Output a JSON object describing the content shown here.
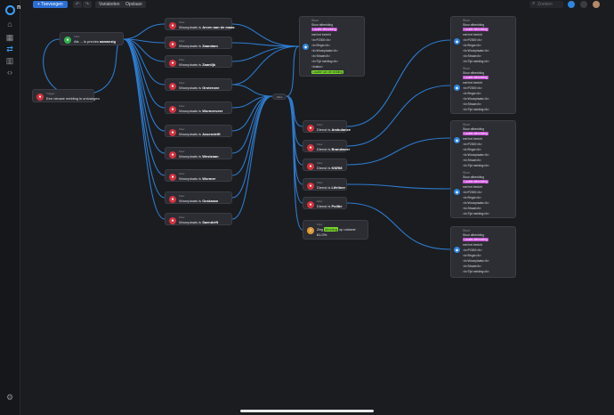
{
  "app": {
    "brand": "n"
  },
  "toolbar": {
    "add_label": "+ Toevoegen",
    "variables_label": "Variabelen",
    "save_label": "Opslaan",
    "search_placeholder": "Zoeken"
  },
  "nodes": {
    "start": {
      "label": "Flow",
      "text": "Als ... is precies",
      "bold": "aanwezig"
    },
    "notice": {
      "label": "Trigger",
      "text": "Een nieuwe melding is ontvangen"
    },
    "wp1": {
      "label": "Flow",
      "text": "Woonplaats is",
      "bold": "Arcen aan de maas"
    },
    "wp2": {
      "label": "Flow",
      "text": "Woonplaats is",
      "bold": "Zaandam"
    },
    "wp3": {
      "label": "Flow",
      "text": "Woonplaats is",
      "bold": "Zaanlijk"
    },
    "wp4": {
      "label": "Flow",
      "text": "Woonplaats is",
      "bold": "Groterone"
    },
    "wp5": {
      "label": "Flow",
      "text": "Woonplaats is",
      "bold": "Wormerveer"
    },
    "wp6": {
      "label": "Flow",
      "text": "Woonplaats is",
      "bold": "Assendelft"
    },
    "wp7": {
      "label": "Flow",
      "text": "Woonplaats is",
      "bold": "Westzaan"
    },
    "wp8": {
      "label": "Flow",
      "text": "Woonplaats is",
      "bold": "Wormer"
    },
    "wp9": {
      "label": "Flow",
      "text": "Woonplaats is",
      "bold": "Oostzaan"
    },
    "wp10": {
      "label": "Flow",
      "text": "Woonplaats is",
      "bold": "Saendelft"
    },
    "mid": "Alles",
    "d1": {
      "label": "Flow",
      "text": "Dienst is",
      "bold": "Ambulance"
    },
    "d2": {
      "label": "Flow",
      "text": "Dienst is",
      "bold": "Brandweer"
    },
    "d3": {
      "label": "Flow",
      "text": "Dienst is",
      "bold": "KNRM"
    },
    "d4": {
      "label": "Flow",
      "text": "Dienst is",
      "bold": "Lifeliner"
    },
    "d5": {
      "label": "Flow",
      "text": "Dienst is",
      "bold": "Politie"
    },
    "speech": {
      "label": "Flow",
      "line1": "Zeg",
      "pill": "Melding",
      "line2": "op volume",
      "line3": "81.0%"
    }
  },
  "cards": {
    "top": {
      "label": "Stuur",
      "title": "Stuur afbeelding",
      "pill": "Locatie afbeelding",
      "lines": [
        "met het bericht",
        "<b>P2000</b>",
        "<b>Regio</b>",
        "<b>Woonplaats</b>",
        "<b>Straat</b>",
        "<b>Tijd melding</b>",
        "<button>"
      ],
      "footer": "Locatie van de melding"
    },
    "r1a": {
      "label": "Stuur",
      "title": "Stuur afbeelding",
      "pill": "Locatie afbeelding",
      "lines": [
        "met het bericht",
        "<b>P2000</b>",
        "<b>Regio</b>",
        "<b>Woonplaats</b>",
        "<b>Straat</b>",
        "<b>Tijd melding</b>"
      ]
    },
    "r1b": {
      "label": "Stuur",
      "title": "Stuur afbeelding",
      "pill": "Locatie afbeelding",
      "lines": [
        "met het bericht",
        "<b>P2000</b>",
        "<b>Regio</b>",
        "<b>Woonplaats</b>",
        "<b>Straat</b>",
        "<b>Tijd melding</b>"
      ]
    },
    "r2a": {
      "label": "Stuur",
      "title": "Stuur afbeelding",
      "pill": "Locatie afbeelding",
      "lines": [
        "met het bericht",
        "<b>P2000</b>",
        "<b>Regio</b>",
        "<b>Woonplaats</b>",
        "<b>Straat</b>",
        "<b>Tijd melding</b>"
      ]
    },
    "r2b": {
      "label": "Stuur",
      "title": "Stuur afbeelding",
      "pill": "Locatie afbeelding",
      "lines": [
        "met het bericht",
        "<b>P2000</b>",
        "<b>Regio</b>",
        "<b>Woonplaats</b>",
        "<b>Straat</b>",
        "<b>Tijd melding</b>"
      ]
    },
    "r3": {
      "label": "Stuur",
      "title": "Stuur afbeelding",
      "pill": "Locatie afbeelding",
      "lines": [
        "met het bericht",
        "<b>P2000</b>",
        "<b>Regio</b>",
        "<b>Woonplaats</b>",
        "<b>Straat</b>",
        "<b>Tijd melding</b>"
      ]
    }
  },
  "colors": {
    "wire": "#2f86e0",
    "accent_green": "#79d82d",
    "accent_purple": "#c84bd6"
  }
}
